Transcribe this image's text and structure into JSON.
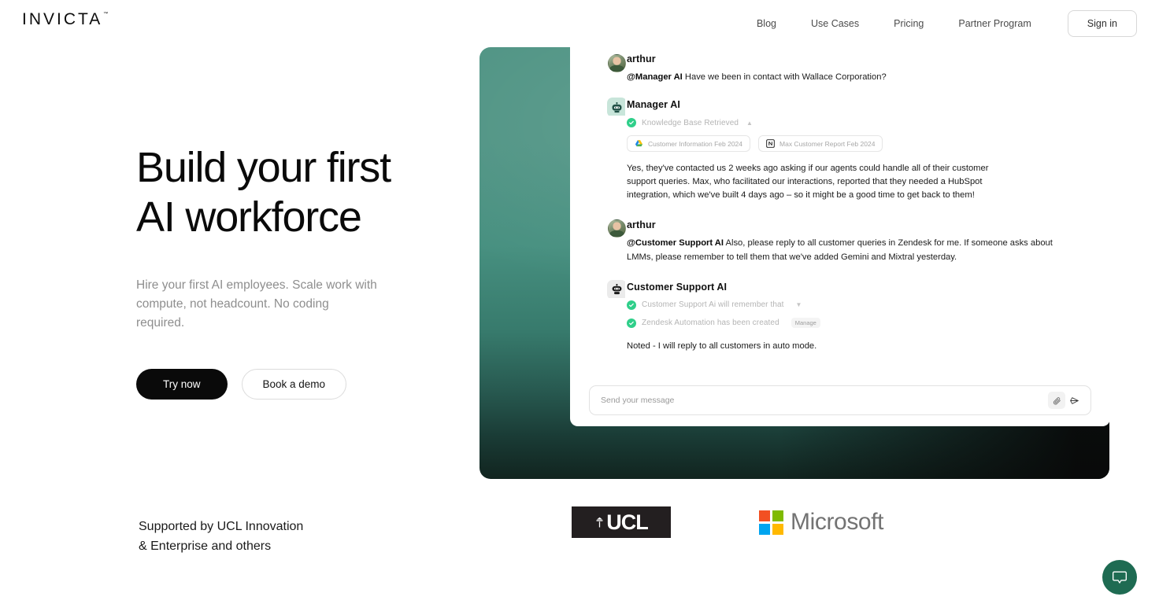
{
  "brand": {
    "name": "INVICTA",
    "tm": "™"
  },
  "nav": {
    "links": [
      {
        "label": "Blog"
      },
      {
        "label": "Use Cases"
      },
      {
        "label": "Pricing"
      },
      {
        "label": "Partner Program"
      }
    ],
    "signin_label": "Sign in"
  },
  "hero": {
    "headline_line1": "Build your first",
    "headline_line2": "AI workforce",
    "subhead": "Hire your first AI employees. Scale work with compute, not headcount. No coding required.",
    "cta_primary": "Try now",
    "cta_secondary": "Book a demo"
  },
  "chat": {
    "messages": [
      {
        "sender": "arthur",
        "avatar_type": "photo",
        "mention": "@Manager AI",
        "text": " Have we been in contact with Wallace Corporation?"
      },
      {
        "sender": "Manager AI",
        "avatar_type": "bot-teal",
        "status": "Knowledge Base Retrieved",
        "chips": [
          {
            "label": "Customer Information Feb 2024",
            "icon": "google-drive-icon"
          },
          {
            "label": "Max Customer Report Feb 2024",
            "icon": "notion-icon"
          }
        ],
        "text": "Yes, they've contacted us 2 weeks ago asking if our agents could handle all of their customer support queries. Max, who facilitated our interactions, reported that they needed a HubSpot integration, which we've built 4 days ago – so it might be a good time to get back to them!"
      },
      {
        "sender": "arthur",
        "avatar_type": "photo",
        "mention": "@Customer Support AI",
        "text": " Also, please reply to all customer queries in Zendesk for me. If someone asks about LMMs, please remember to tell them that we've added Gemini and Mixtral yesterday."
      },
      {
        "sender": "Customer Support AI",
        "avatar_type": "bot-gray",
        "status1": "Customer Support Ai will remember that",
        "status2": "Zendesk Automation has been created",
        "manage_label": "Manage",
        "text": "Noted - I will reply to all customers in auto mode."
      }
    ],
    "input_placeholder": "Send your message"
  },
  "supported": {
    "line1": "Supported by UCL Innovation",
    "line2": "& Enterprise and others",
    "logos": [
      {
        "name": "UCL",
        "text": "UCL"
      },
      {
        "name": "Microsoft",
        "text": "Microsoft"
      }
    ]
  },
  "colors": {
    "panel_top": "#4e9383",
    "panel_bottom": "#11241f",
    "accent_green": "#2fcf8a",
    "widget_green": "#1e6b52",
    "ms_red": "#f25022",
    "ms_green": "#7fba00",
    "ms_blue": "#00a4ef",
    "ms_yellow": "#ffb900"
  }
}
